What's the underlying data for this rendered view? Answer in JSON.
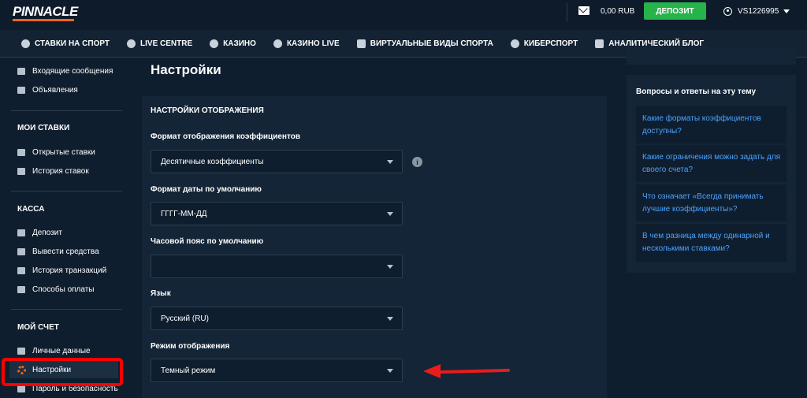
{
  "header": {
    "logo": "PINNACLE",
    "balance": "0,00 RUB",
    "deposit_label": "ДЕПОЗИТ",
    "username": "VS1226995"
  },
  "nav": {
    "items": [
      {
        "label": "СТАВКИ НА СПОРТ",
        "icon": "soccer-ball-icon"
      },
      {
        "label": "LIVE CENTRE",
        "icon": "live-icon"
      },
      {
        "label": "КАЗИНО",
        "icon": "casino-chip-icon"
      },
      {
        "label": "КАЗИНО LIVE",
        "icon": "live-casino-icon"
      },
      {
        "label": "ВИРТУАЛЬНЫЕ ВИДЫ СПОРТА",
        "icon": "monitor-icon"
      },
      {
        "label": "КИБЕРСПОРТ",
        "icon": "headset-icon"
      },
      {
        "label": "АНАЛИТИЧЕСКИЙ БЛОГ",
        "icon": "document-icon"
      }
    ]
  },
  "sidebar": {
    "inbox": "Входящие сообщения",
    "announcements": "Объявления",
    "bets_header": "МОИ СТАВКИ",
    "open_bets": "Открытые ставки",
    "bet_history": "История ставок",
    "cashier_header": "КАССА",
    "deposit": "Депозит",
    "withdraw": "Вывести средства",
    "transaction_history": "История транзакций",
    "payment_methods": "Способы оплаты",
    "account_header": "МОЙ СЧЕТ",
    "personal_data": "Личные данные",
    "settings": "Настройки",
    "password_security": "Пароль и безопасность"
  },
  "main": {
    "page_title": "Настройки",
    "panel_title": "НАСТРОЙКИ ОТОБРАЖЕНИЯ",
    "odds_format_label": "Формат отображения коэффициентов",
    "odds_format_value": "Десятичные коэффициенты",
    "date_format_label": "Формат даты по умолчанию",
    "date_format_value": "ГГГГ-ММ-ДД",
    "timezone_label": "Часовой пояс по умолчанию",
    "timezone_value": "",
    "language_label": "Язык",
    "language_value": "Русский (RU)",
    "display_mode_label": "Режим отображения",
    "display_mode_value": "Темный режим",
    "info_glyph": "i"
  },
  "faq": {
    "title": "Вопросы и ответы на эту тему",
    "q1": "Какие форматы коэффициентов доступны?",
    "q2": "Какие ограничения можно задать для своего счета?",
    "q3": "Что означает «Всегда принимать лучшие коэффициенты»?",
    "q4": "В чем разница между одинарной и несколькими ставками?"
  },
  "colors": {
    "accent_green": "#26b34a",
    "link_blue": "#4aa3ff",
    "annotation_red": "#e81c1c",
    "brand_orange": "#f26522"
  }
}
